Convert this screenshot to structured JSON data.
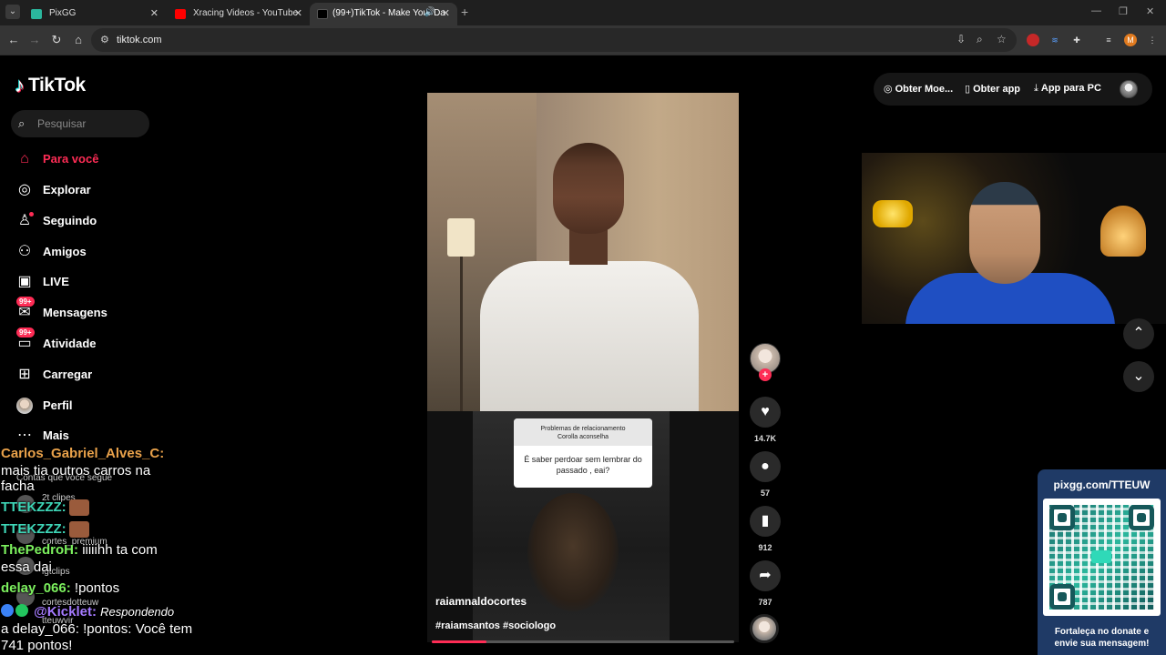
{
  "browser": {
    "tabs": [
      {
        "title": "PixGG",
        "active": false
      },
      {
        "title": "Xracing Videos - YouTube",
        "active": false
      },
      {
        "title": "(99+)TikTok - Make Your Da",
        "active": true
      }
    ],
    "url": "tiktok.com"
  },
  "sidebar": {
    "logo": "TikTok",
    "search_placeholder": "Pesquisar",
    "nav": [
      {
        "label": "Para você",
        "icon": "home-icon",
        "active": true
      },
      {
        "label": "Explorar",
        "icon": "compass-icon"
      },
      {
        "label": "Seguindo",
        "icon": "user-follow-icon"
      },
      {
        "label": "Amigos",
        "icon": "friends-icon"
      },
      {
        "label": "LIVE",
        "icon": "live-icon"
      },
      {
        "label": "Mensagens",
        "icon": "message-icon",
        "badge": "99+"
      },
      {
        "label": "Atividade",
        "icon": "activity-icon",
        "badge": "99+"
      },
      {
        "label": "Carregar",
        "icon": "upload-icon"
      },
      {
        "label": "Perfil",
        "icon": "profile-avatar"
      },
      {
        "label": "Mais",
        "icon": "more-icon"
      }
    ],
    "following_title": "Contas que você segue",
    "following": [
      "2t clipes",
      "cortes_premium",
      "igtclips",
      "cortesdotteuw",
      "tteuwvir"
    ]
  },
  "chat": [
    {
      "user": "Carlos_Gabriel_Alves_C:",
      "message": ""
    },
    {
      "user": "",
      "message": "mais tia outros carros na"
    },
    {
      "user": "",
      "message": "facha"
    },
    {
      "user": "TTEKZZZ:",
      "message": ""
    },
    {
      "user": "TTEKZZZ:",
      "message": ""
    },
    {
      "user": "ThePedroH:",
      "message": "iiiiihh ta com"
    },
    {
      "user": "",
      "message": "essa dai"
    },
    {
      "user": "delay_066:",
      "message": "!pontos"
    },
    {
      "user": "@Kicklet:",
      "message": "Respondendo"
    },
    {
      "user": "",
      "message": "a delay_066: !pontos: Você tem"
    },
    {
      "user": "",
      "message": "741 pontos!"
    }
  ],
  "topbar": {
    "coins": "Obter Moe...",
    "app": "Obter app",
    "pc": "App para PC"
  },
  "video": {
    "question_header_1": "Problemas de relacionamento",
    "question_header_2": "Corolla aconselha",
    "question_body": "É saber perdoar sem lembrar do passado , eai?",
    "author": "raiamnaldocortes",
    "tags": "#raiamsantos #sociologo",
    "progress": 0.18
  },
  "actions": {
    "likes": "14.7K",
    "comments": "57",
    "saves": "912",
    "shares": "787"
  },
  "donate": {
    "url": "pixgg.com/TTEUW",
    "message_1": "Fortaleça no donate e",
    "message_2": "envie sua mensagem!"
  },
  "colors": {
    "accent": "#fe2c55",
    "donate_bg": "#1f3a66"
  }
}
